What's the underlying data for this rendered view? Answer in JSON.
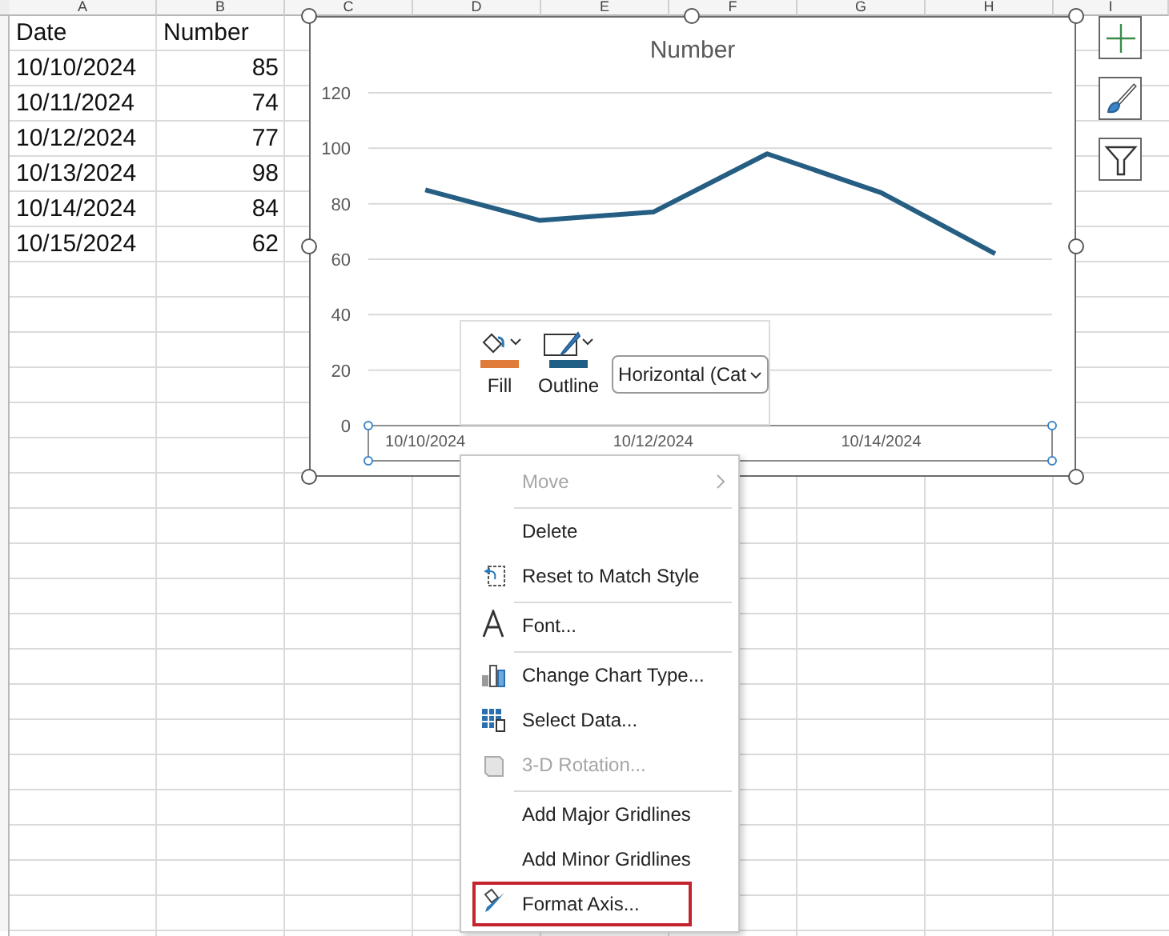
{
  "sheet": {
    "column_headers": [
      "A",
      "B",
      "C",
      "D",
      "E",
      "F",
      "G",
      "H",
      "I"
    ],
    "header_row": [
      "Date",
      "Number"
    ],
    "rows": [
      [
        "10/10/2024",
        "85"
      ],
      [
        "10/11/2024",
        "74"
      ],
      [
        "10/12/2024",
        "77"
      ],
      [
        "10/13/2024",
        "98"
      ],
      [
        "10/14/2024",
        "84"
      ],
      [
        "10/15/2024",
        "62"
      ]
    ]
  },
  "chart": {
    "selected": true,
    "axis_selected": true,
    "chart_data": {
      "type": "line",
      "title": "Number",
      "grid": true,
      "categories": [
        "10/10/2024",
        null,
        "10/12/2024",
        null,
        "10/14/2024",
        null
      ],
      "series": [
        {
          "color": "#255e82",
          "values": [
            85,
            74,
            77,
            98,
            84,
            62
          ]
        }
      ],
      "ylim": [
        0,
        120
      ],
      "yticks": [
        0,
        20,
        40,
        60,
        80,
        100,
        120
      ]
    }
  },
  "format_toolbar": {
    "buttons": [
      {
        "label": "Fill",
        "color": "#e07b39"
      },
      {
        "label": "Outline",
        "color": "#1f5f86"
      }
    ],
    "dropdown": {
      "value": "Horizontal (Cat"
    }
  },
  "context_menu": {
    "items": [
      {
        "label": "Move",
        "disabled": true,
        "submenu": true,
        "separator_before": false,
        "highlighted": false
      },
      {
        "label": "Delete",
        "disabled": false,
        "submenu": false,
        "separator_before": true,
        "highlighted": false
      },
      {
        "label": "Reset to Match Style",
        "disabled": false,
        "submenu": false,
        "separator_before": false,
        "highlighted": false
      },
      {
        "label": "Font...",
        "disabled": false,
        "submenu": false,
        "separator_before": true,
        "highlighted": false
      },
      {
        "label": "Change Chart Type...",
        "disabled": false,
        "submenu": false,
        "separator_before": true,
        "highlighted": false
      },
      {
        "label": "Select Data...",
        "disabled": false,
        "submenu": false,
        "separator_before": false,
        "highlighted": false
      },
      {
        "label": "3-D Rotation...",
        "disabled": true,
        "submenu": false,
        "separator_before": false,
        "highlighted": false
      },
      {
        "label": "Add Major Gridlines",
        "disabled": false,
        "submenu": false,
        "separator_before": true,
        "highlighted": false
      },
      {
        "label": "Add Minor Gridlines",
        "disabled": false,
        "submenu": false,
        "separator_before": false,
        "highlighted": false
      },
      {
        "label": "Format Axis...",
        "disabled": false,
        "submenu": false,
        "separator_before": false,
        "highlighted": true
      }
    ]
  }
}
